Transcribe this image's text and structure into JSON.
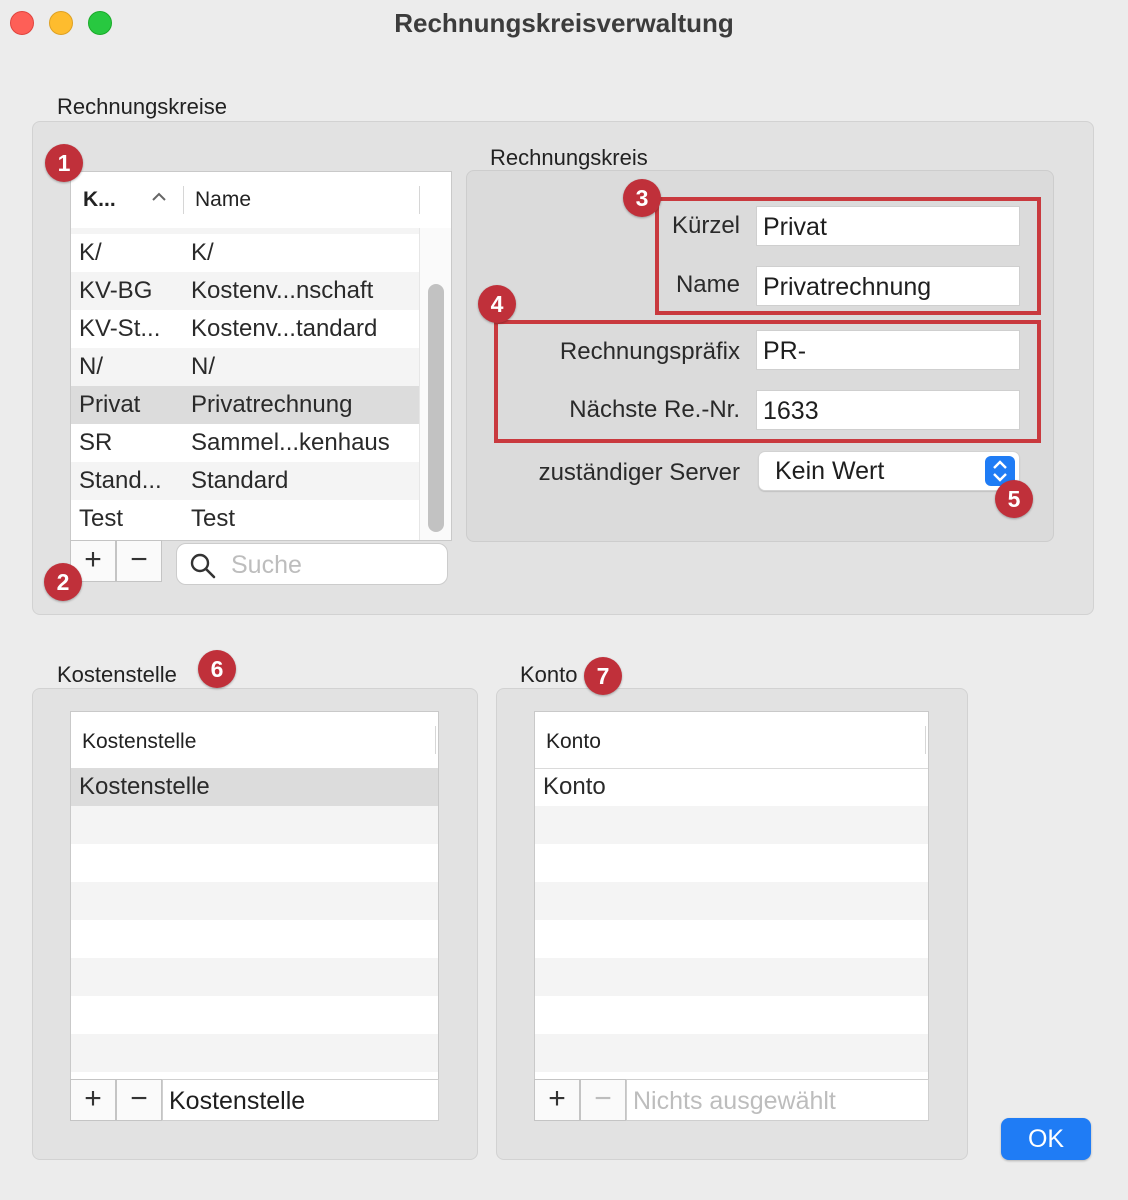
{
  "window": {
    "title": "Rechnungskreisverwaltung"
  },
  "rechnungskreise": {
    "group_label": "Rechnungskreise",
    "table": {
      "col_kuerzel": "K...",
      "col_name": "Name",
      "sort_indicator": "^",
      "rows": [
        {
          "kuerzel": "K/",
          "name": "K/"
        },
        {
          "kuerzel": "KV-BG",
          "name": "Kostenv...nschaft"
        },
        {
          "kuerzel": "KV-St...",
          "name": "Kostenv...tandard"
        },
        {
          "kuerzel": "N/",
          "name": "N/"
        },
        {
          "kuerzel": "Privat",
          "name": "Privatrechnung"
        },
        {
          "kuerzel": "SR",
          "name": "Sammel...kenhaus"
        },
        {
          "kuerzel": "Stand...",
          "name": "Standard"
        },
        {
          "kuerzel": "Test",
          "name": "Test"
        }
      ],
      "selected_index": 4
    },
    "add_label": "+",
    "remove_label": "−",
    "search_placeholder": "Suche"
  },
  "rechnungskreis": {
    "group_label": "Rechnungskreis",
    "kuerzel_label": "Kürzel",
    "kuerzel_value": "Privat",
    "name_label": "Name",
    "name_value": "Privatrechnung",
    "praefix_label": "Rechnungspräfix",
    "praefix_value": "PR-",
    "naechste_label": "Nächste Re.-Nr.",
    "naechste_value": "1633",
    "server_label": "zuständiger Server",
    "server_value": "Kein Wert"
  },
  "kostenstelle": {
    "group_label": "Kostenstelle",
    "column": "Kostenstelle",
    "rows": [
      "Kostenstelle"
    ],
    "add_label": "+",
    "remove_label": "−",
    "field_value": "Kostenstelle"
  },
  "konto": {
    "group_label": "Konto",
    "column": "Konto",
    "rows": [
      "Konto"
    ],
    "add_label": "+",
    "remove_label": "−",
    "field_placeholder": "Nichts ausgewählt"
  },
  "badges": [
    "1",
    "2",
    "3",
    "4",
    "5",
    "6",
    "7"
  ],
  "ok_label": "OK",
  "colors": {
    "accent": "#1f7cf5",
    "badge": "#c0303a",
    "highlight_border": "#c9393e"
  }
}
